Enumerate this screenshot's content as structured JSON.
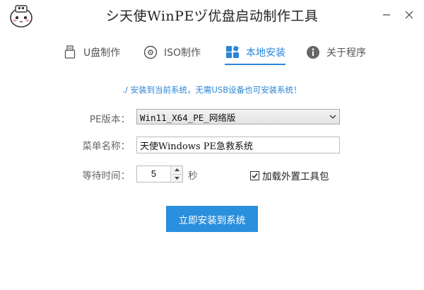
{
  "window": {
    "title": "シ天使WinPEヅ优盘启动制作工具",
    "logo_icon": "panda-logo-icon",
    "minimize_icon": "minimize-icon",
    "close_icon": "close-icon"
  },
  "tabs": [
    {
      "label": "U盘制作",
      "icon": "usb-icon",
      "active": false
    },
    {
      "label": "ISO制作",
      "icon": "disc-icon",
      "active": false
    },
    {
      "label": "本地安装",
      "icon": "grid-install-icon",
      "active": true
    },
    {
      "label": "关于程序",
      "icon": "info-icon",
      "active": false
    }
  ],
  "accent_color": "#2a86d8",
  "notice": "./ 安装到当前系统，无需USB设备也可安装系统！",
  "form": {
    "pe_version_label": "PE版本：",
    "pe_version_value": "Win11_X64_PE_网络版",
    "menu_name_label": "菜单名称：",
    "menu_name_value": "天使Windows PE急救系统",
    "wait_time_label": "等待时间：",
    "wait_time_value": "5",
    "wait_time_unit": "秒",
    "load_tools_label": "加载外置工具包",
    "load_tools_checked": true
  },
  "install_button": "立即安装到系统"
}
